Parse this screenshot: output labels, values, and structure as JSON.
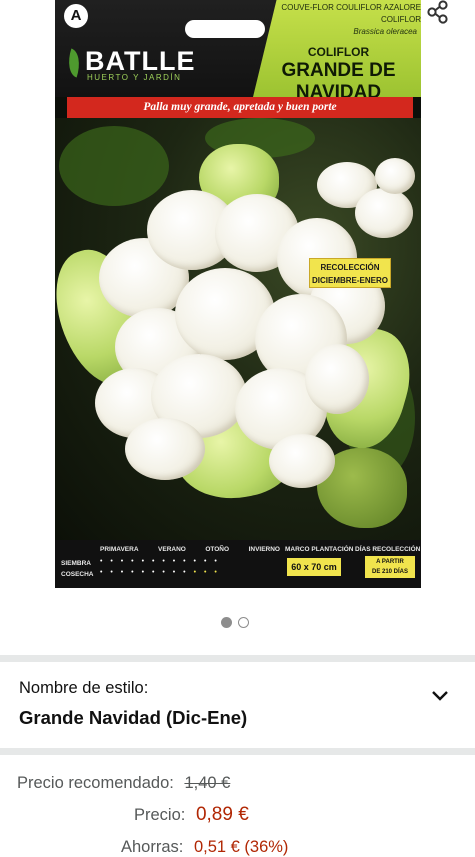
{
  "packet": {
    "corner_badge": "A",
    "brand": "BATLLE",
    "brand_sub": "HUERTO Y JARDÍN",
    "varieties": "COUVE-FLOR COULIFLOR AZALORE COLIFLOR",
    "species": "Brassica oleracea",
    "kind": "COLIFLOR",
    "variety": "GRANDE DE NAVIDAD",
    "slogan": "Palla muy grande, apretada y buen porte",
    "harvest_line1": "RECOLECCIÓN",
    "harvest_line2": "DICIEMBRE-ENERO",
    "seasons": [
      "PRIMAVERA",
      "VERANO",
      "OTOÑO",
      "INVIERNO"
    ],
    "row_sowing": "SIEMBRA",
    "row_harvest": "COSECHA",
    "spacing_label": "MARCO PLANTACIÓN",
    "spacing_value": "60 x 70 cm",
    "days_label": "DÍAS RECOLECCIÓN",
    "days_line1": "A PARTIR",
    "days_line2": "DE 210 DÍAS"
  },
  "icons": {
    "share": "share-icon",
    "chevron": "chevron-down-icon"
  },
  "carousel": {
    "total": 2,
    "active": 1
  },
  "style_selector": {
    "label": "Nombre de estilo:",
    "value": "Grande Navidad (Dic-Ene)"
  },
  "pricing": {
    "list_label": "Precio recomendado:",
    "list_price": "1,40 €",
    "price_label": "Precio:",
    "price": "0,89 €",
    "savings_label": "Ahorras:",
    "savings": "0,51 € (36%)"
  },
  "colors": {
    "price_red": "#b12704",
    "muted_text": "#565959",
    "divider": "#e6e8e8"
  }
}
